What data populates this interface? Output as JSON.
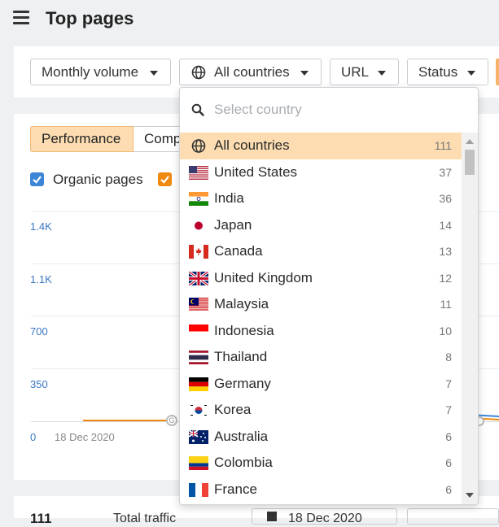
{
  "header": {
    "title": "Top pages"
  },
  "filters": {
    "volume": "Monthly volume",
    "countries": "All countries",
    "url": "URL",
    "status": "Status"
  },
  "chart_panel": {
    "tabs": [
      "Performance",
      "Comp"
    ],
    "checkbox_label": "Organic pages",
    "y_ticks": [
      "1.4K",
      "1.1K",
      "700",
      "350",
      "0"
    ],
    "x_tick": "18 Dec 2020",
    "marker_label": "G"
  },
  "bottom_bar": {
    "count": "111",
    "traffic_label": "Total traffic",
    "date": "18 Dec 2020"
  },
  "country_dropdown": {
    "search_placeholder": "Select country",
    "items": [
      {
        "name": "All countries",
        "count": "111",
        "flag": "globe-icon"
      },
      {
        "name": "United States",
        "count": "37",
        "flag": "us"
      },
      {
        "name": "India",
        "count": "36",
        "flag": "in"
      },
      {
        "name": "Japan",
        "count": "14",
        "flag": "jp"
      },
      {
        "name": "Canada",
        "count": "13",
        "flag": "ca"
      },
      {
        "name": "United Kingdom",
        "count": "12",
        "flag": "gb"
      },
      {
        "name": "Malaysia",
        "count": "11",
        "flag": "my"
      },
      {
        "name": "Indonesia",
        "count": "10",
        "flag": "id"
      },
      {
        "name": "Thailand",
        "count": "8",
        "flag": "th"
      },
      {
        "name": "Germany",
        "count": "7",
        "flag": "de"
      },
      {
        "name": "Korea",
        "count": "7",
        "flag": "kr"
      },
      {
        "name": "Australia",
        "count": "6",
        "flag": "au"
      },
      {
        "name": "Colombia",
        "count": "6",
        "flag": "co"
      },
      {
        "name": "France",
        "count": "6",
        "flag": "fr"
      }
    ]
  },
  "colors": {
    "accent": "#fcdcb0",
    "link_blue": "#3a77c4",
    "orange": "#f0890f",
    "checkbox_blue": "#3d86d6"
  }
}
